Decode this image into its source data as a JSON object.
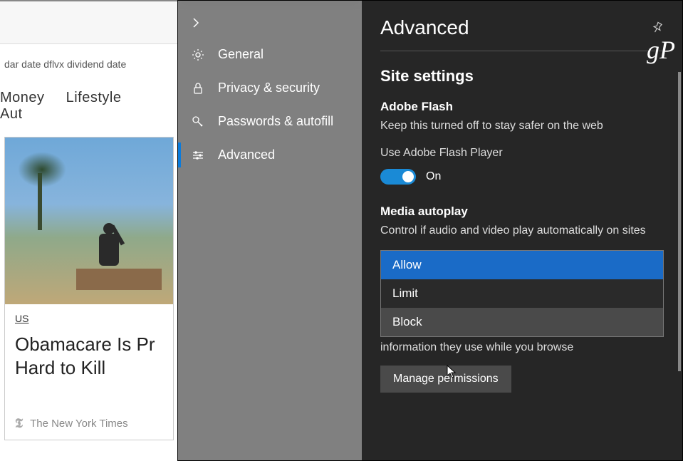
{
  "background": {
    "tags": "dar  date   dflvx dividend date",
    "nav": [
      "Money",
      "Lifestyle",
      "Aut"
    ],
    "card": {
      "category": "US",
      "headline": "Obamacare Is Pr    Hard to Kill",
      "source": "The New York Times"
    }
  },
  "menu": {
    "items": [
      {
        "id": "general",
        "label": "General"
      },
      {
        "id": "privacy",
        "label": "Privacy & security"
      },
      {
        "id": "passwords",
        "label": "Passwords & autofill"
      },
      {
        "id": "advanced",
        "label": "Advanced"
      }
    ]
  },
  "settings": {
    "title": "Advanced",
    "watermark": "gP",
    "section": "Site settings",
    "flash": {
      "title": "Adobe Flash",
      "desc": "Keep this turned off to stay safer on the web",
      "toggle_label": "Use Adobe Flash Player",
      "state": "On"
    },
    "autoplay": {
      "title": "Media autoplay",
      "desc": "Control if audio and video play automatically on sites",
      "options": [
        "Allow",
        "Limit",
        "Block"
      ],
      "behind": "information they use while you browse"
    },
    "manage_btn": "Manage permissions"
  }
}
